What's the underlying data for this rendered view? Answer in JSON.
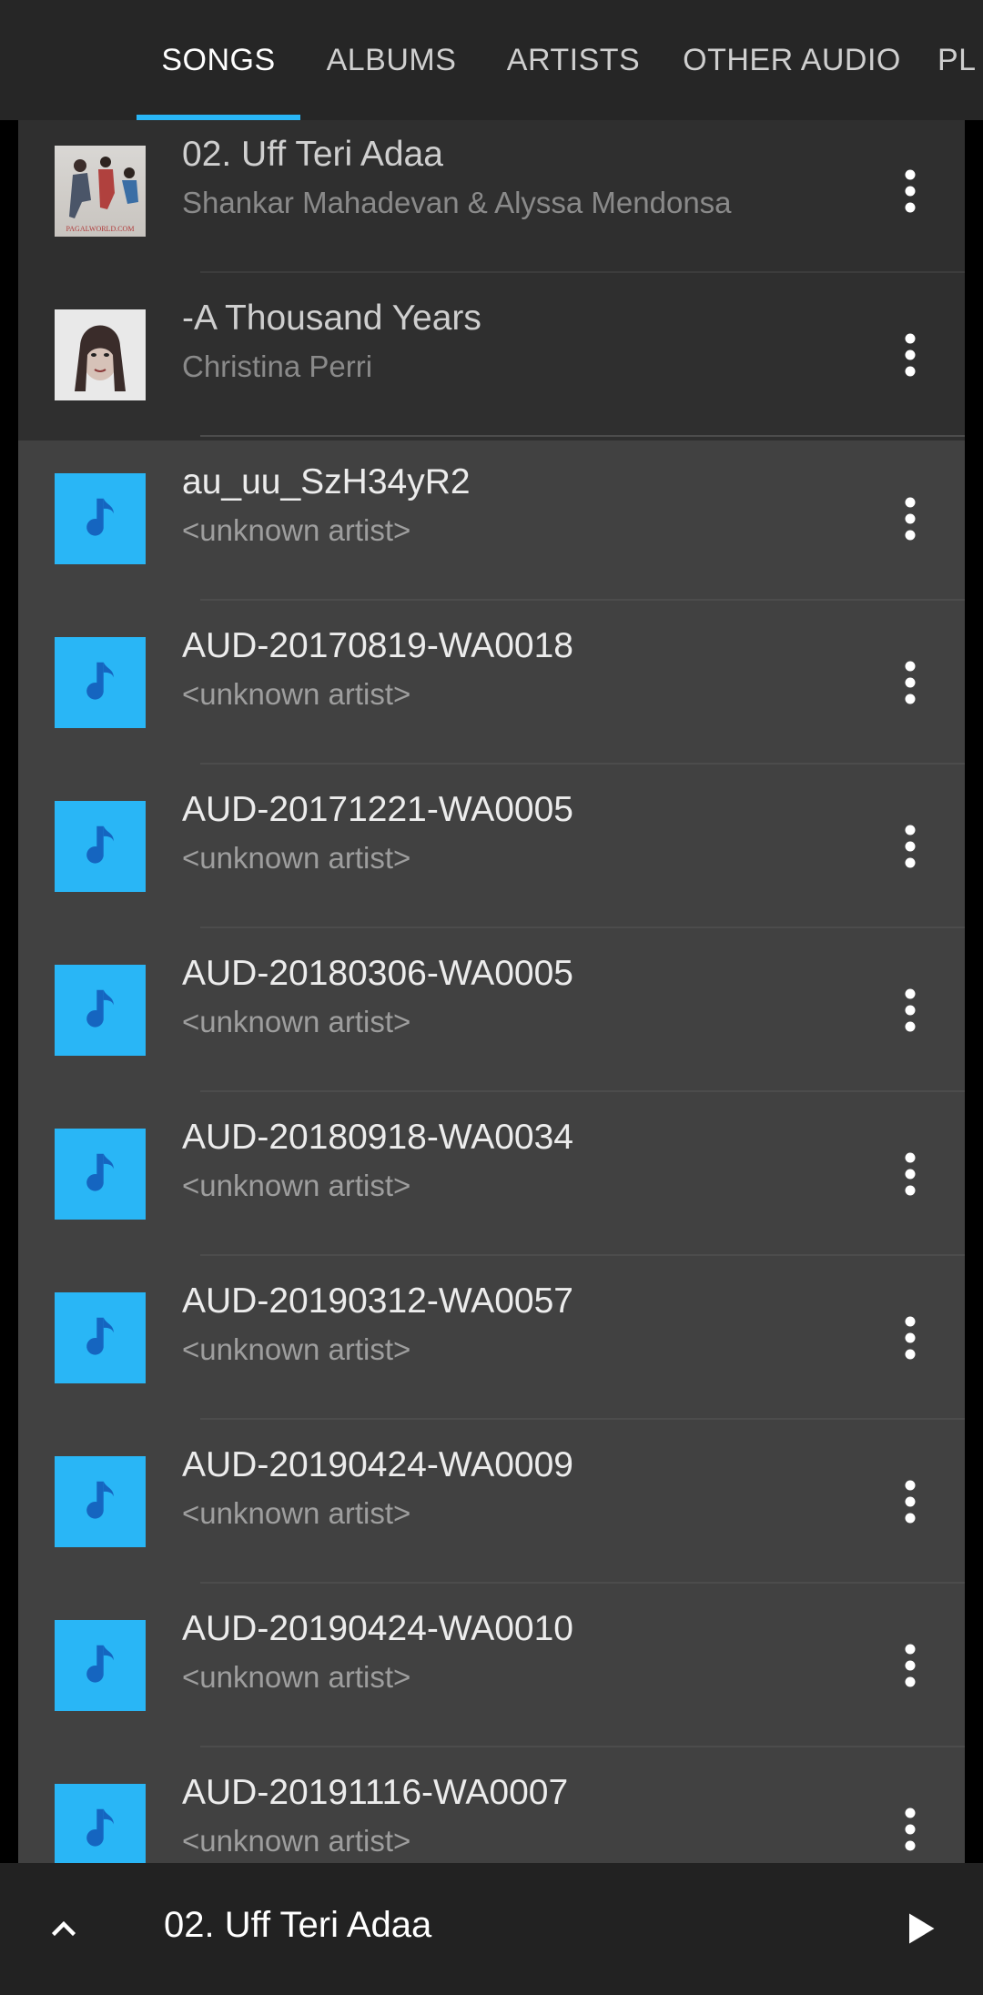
{
  "tabs": [
    {
      "label": "SONGS",
      "active": true
    },
    {
      "label": "ALBUMS",
      "active": false
    },
    {
      "label": "ARTISTS",
      "active": false
    },
    {
      "label": "OTHER AUDIO",
      "active": false
    },
    {
      "label": "PL",
      "active": false
    }
  ],
  "colors": {
    "accent": "#29b6f6",
    "note_icon": "#1565c0"
  },
  "songs": [
    {
      "title": "02. Uff Teri Adaa",
      "artist": "Shankar Mahadevan & Alyssa Mendonsa",
      "art": "album-art",
      "art_text": "PAGALWORLD.COM"
    },
    {
      "title": "-A Thousand Years",
      "artist": "Christina Perri",
      "art": "album-art"
    },
    {
      "title": "au_uu_SzH34yR2",
      "artist": "<unknown artist>",
      "art": "music-note-icon"
    },
    {
      "title": "AUD-20170819-WA0018",
      "artist": "<unknown artist>",
      "art": "music-note-icon"
    },
    {
      "title": "AUD-20171221-WA0005",
      "artist": "<unknown artist>",
      "art": "music-note-icon"
    },
    {
      "title": "AUD-20180306-WA0005",
      "artist": "<unknown artist>",
      "art": "music-note-icon"
    },
    {
      "title": "AUD-20180918-WA0034",
      "artist": "<unknown artist>",
      "art": "music-note-icon"
    },
    {
      "title": "AUD-20190312-WA0057",
      "artist": "<unknown artist>",
      "art": "music-note-icon"
    },
    {
      "title": "AUD-20190424-WA0009",
      "artist": "<unknown artist>",
      "art": "music-note-icon"
    },
    {
      "title": "AUD-20190424-WA0010",
      "artist": "<unknown artist>",
      "art": "music-note-icon"
    },
    {
      "title": "AUD-20191116-WA0007",
      "artist": "<unknown artist>",
      "art": "music-note-icon"
    }
  ],
  "now_playing": {
    "title": "02. Uff Teri Adaa",
    "expand_icon": "chevron-up-icon",
    "play_icon": "play-icon"
  }
}
